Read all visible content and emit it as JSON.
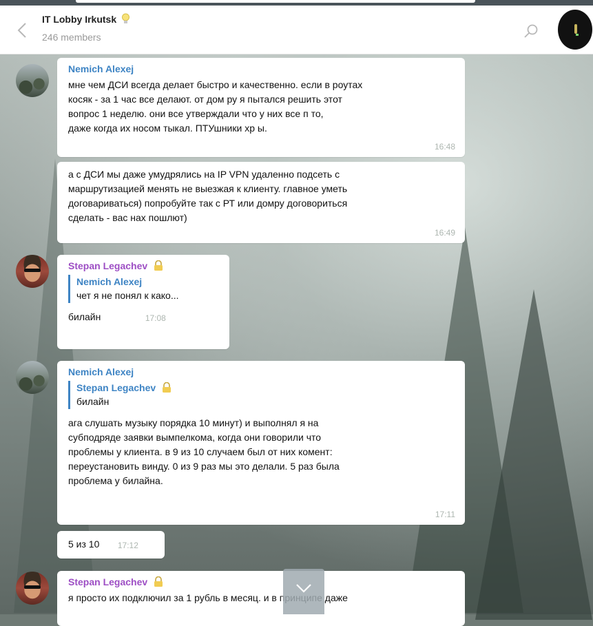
{
  "header": {
    "title": "IT Lobby Irkutsk",
    "members": "246 members"
  },
  "colors": {
    "sender_blue": "#3e84c4",
    "sender_purple": "#9d4ec4",
    "time_gray": "#adb6b0"
  },
  "icons": {
    "back": "chevron-left-icon",
    "title_badge": "lightbulb-icon",
    "search": "search-icon",
    "sender_badge": "lock-icon",
    "scroll": "chevron-down-icon"
  },
  "messages": [
    {
      "sender": "Nemich Alexej",
      "text": "мне чем ДСИ всегда делает быстро и качественно. если в роутах\nкосяк - за 1 час все делают. от дом ру я пытался решить этот\nвопрос 1 неделю. они все утверждали что у них все п     то,\nдаже когда их носом тыкал. ПТУшники хр      ы.",
      "time": "16:48"
    },
    {
      "text": "а с ДСИ мы даже умудрялись на IP VPN удаленно подсеть с\nмаршрутизацией менять не выезжая к клиенту. главное уметь\nдоговариваться) попробуйте так с РТ или домру договориться\nсделать - вас нах пошлют)",
      "time": "16:49"
    },
    {
      "sender": "Stepan Legachev",
      "reply_name": "Nemich Alexej",
      "reply_text": "чет я не понял к како...",
      "text": "билайн",
      "time": "17:08"
    },
    {
      "sender": "Nemich Alexej",
      "reply_name": "Stepan Legachev",
      "reply_text": "билайн",
      "text": "ага слушать музыку порядка 10 минут) и выполнял я на\nсубподряде заявки вымпелкома, когда они говорили что\nпроблемы у клиента. в 9 из 10 случаем был от них комент:\nпереустановить винду. 0 из  9 раз мы это делали. 5 раз была\nпроблема у билайна.",
      "time": "17:11"
    },
    {
      "text": "5 из 10",
      "time": "17:12"
    },
    {
      "sender": "Stepan Legachev",
      "text": "я просто их подключил за 1 рубль в месяц. и в принципе даже"
    }
  ]
}
